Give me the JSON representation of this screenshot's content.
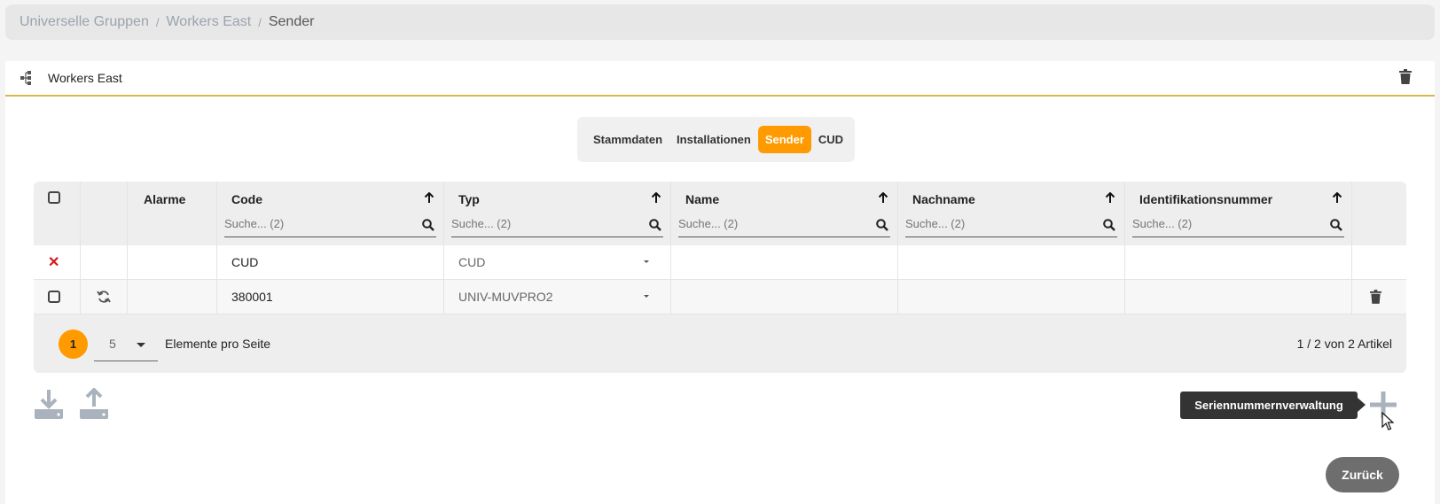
{
  "breadcrumb": {
    "items": [
      "Universelle Gruppen",
      "Workers East"
    ],
    "current": "Sender",
    "separator": "/"
  },
  "card": {
    "title": "Workers East"
  },
  "tabs": [
    {
      "label": "Stammdaten",
      "active": false
    },
    {
      "label": "Installationen",
      "active": false
    },
    {
      "label": "Sender",
      "active": true
    },
    {
      "label": "CUD",
      "active": false
    }
  ],
  "table": {
    "headers": {
      "alarme": "Alarme",
      "code": "Code",
      "typ": "Typ",
      "name": "Name",
      "nachname": "Nachname",
      "ident": "Identifikationsnummer"
    },
    "search_placeholder": "Suche... (2)",
    "rows": [
      {
        "code": "CUD",
        "typ": "CUD",
        "name": "",
        "nachname": "",
        "ident": ""
      },
      {
        "code": "380001",
        "typ": "UNIV-MUVPRO2",
        "name": "",
        "nachname": "",
        "ident": ""
      }
    ]
  },
  "pager": {
    "current_page": "1",
    "page_size": "5",
    "per_page_label": "Elemente pro Seite",
    "info": "1 / 2 von 2 Artikel"
  },
  "tooltip": "Seriennummernverwaltung",
  "back_button": "Zurück",
  "colors": {
    "accent": "#ff9a00",
    "header_line": "#d8b84a",
    "danger": "#d6191b"
  }
}
